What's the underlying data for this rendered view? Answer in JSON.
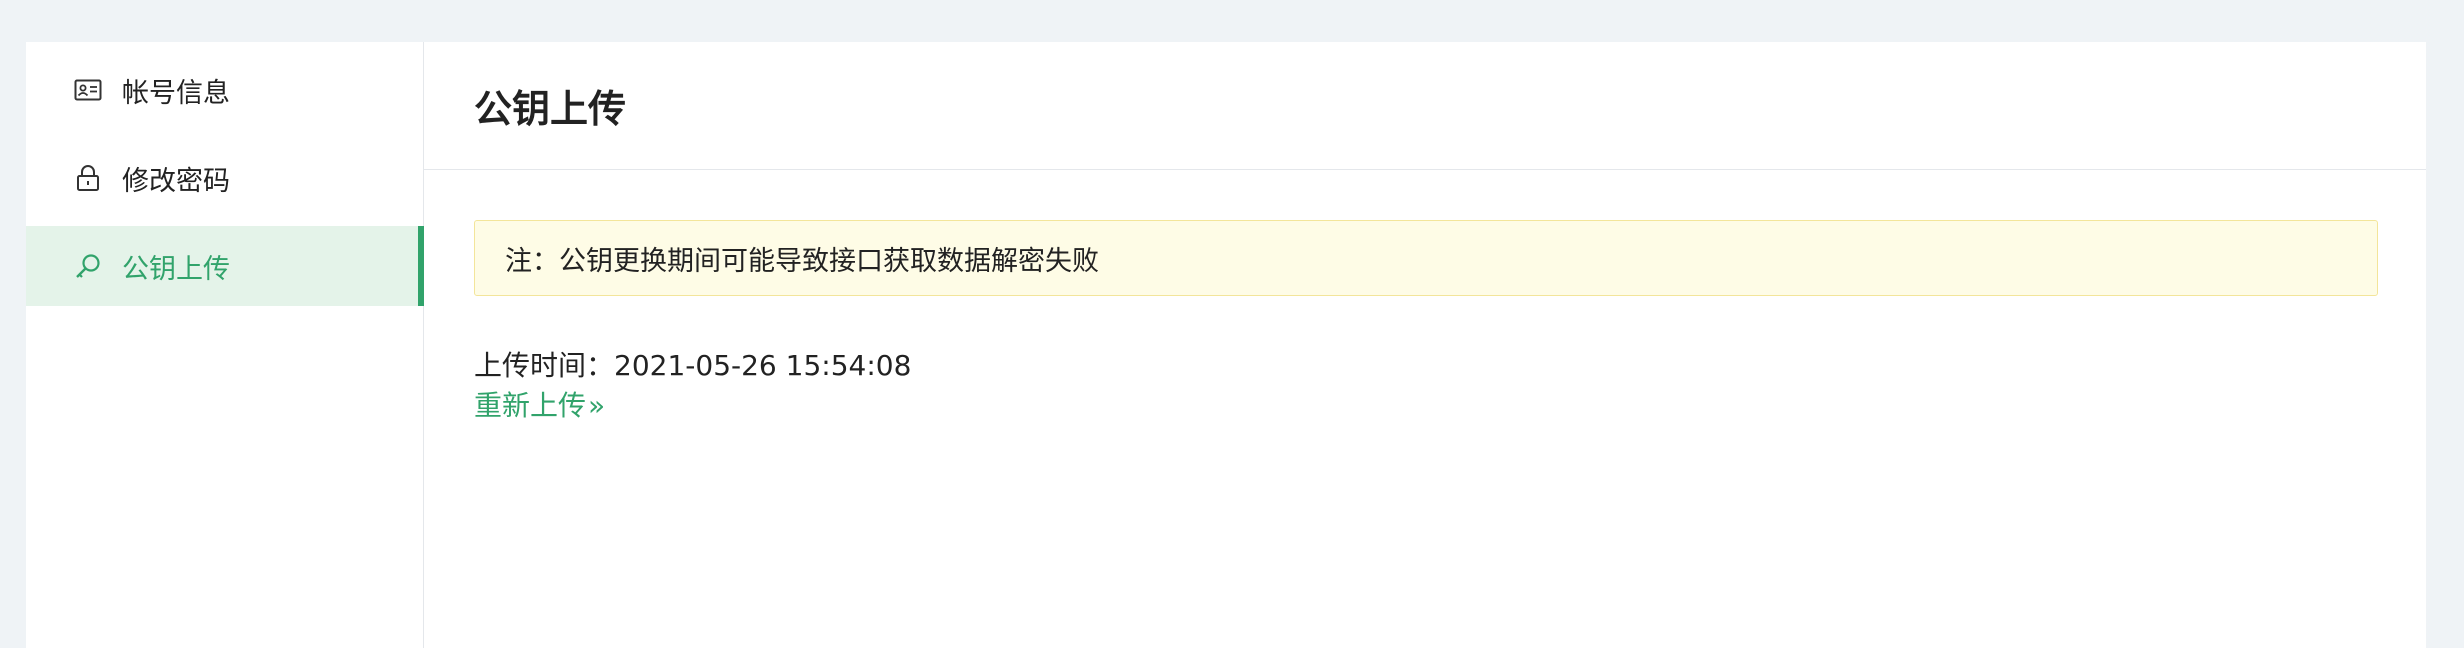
{
  "sidebar": {
    "items": [
      {
        "label": "帐号信息",
        "icon": "id-card-icon",
        "active": false
      },
      {
        "label": "修改密码",
        "icon": "lock-icon",
        "active": false
      },
      {
        "label": "公钥上传",
        "icon": "key-icon",
        "active": true
      }
    ]
  },
  "main": {
    "title": "公钥上传",
    "notice": "注：公钥更换期间可能导致接口获取数据解密失败",
    "upload_time_label": "上传时间：",
    "upload_time_value": "2021-05-26 15:54:08",
    "reupload_label": "重新上传",
    "reupload_arrows": "»"
  },
  "colors": {
    "accent": "#31a36b",
    "active_bg": "#e4f3e9",
    "notice_bg": "#fefce6",
    "notice_border": "#f3e59a",
    "page_bg": "#eff3f6"
  }
}
